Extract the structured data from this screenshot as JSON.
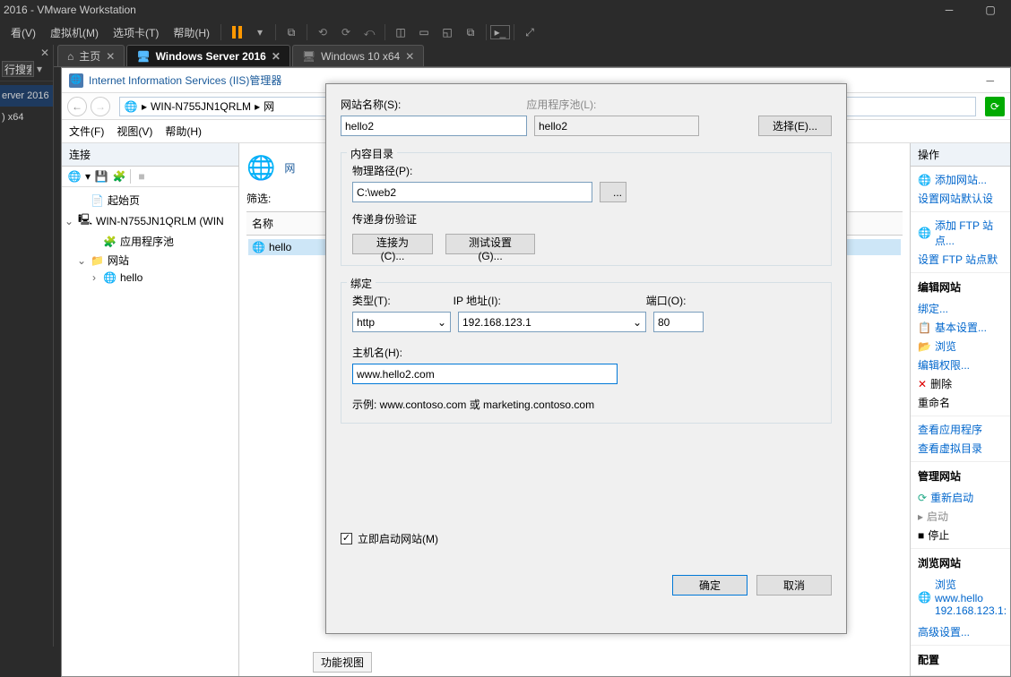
{
  "titlebar": {
    "text": "2016 - VMware Workstation"
  },
  "menu": {
    "view": "看(V)",
    "vm": "虚拟机(M)",
    "tabs": "选项卡(T)",
    "help": "帮助(H)"
  },
  "left_sliver": {
    "search": "行搜索",
    "entry1": "erver 2016",
    "entry2": ") x64"
  },
  "tabs": {
    "home": "主页",
    "active": "Windows Server 2016",
    "other": "Windows 10 x64"
  },
  "iis": {
    "title": "Internet Information Services (IIS)管理器",
    "path_host": "WIN-N755JN1QRLM",
    "path_arrow": "▸",
    "path_tail": "网",
    "menu_file": "文件(F)",
    "menu_view": "视图(V)",
    "menu_help": "帮助(H)",
    "left_hdr": "连接",
    "tree_start": "起始页",
    "tree_host": "WIN-N755JN1QRLM (WIN",
    "tree_pool": "应用程序池",
    "tree_sites": "网站",
    "tree_hello": "hello",
    "mid_title": "网",
    "mid_filter": "筛选:",
    "mid_col": "名称",
    "mid_item": "hello",
    "right_hdr": "操作",
    "act_add": "添加网站...",
    "act_def": "设置网站默认设",
    "act_ftp_add": "添加 FTP 站点...",
    "act_ftp_def": "设置 FTP 站点默",
    "sec_edit": "编辑网站",
    "act_bind": "绑定...",
    "act_basic": "基本设置...",
    "act_browse": "浏览",
    "act_perm": "编辑权限...",
    "act_delete": "删除",
    "act_rename": "重命名",
    "act_apps": "查看应用程序",
    "act_vdirs": "查看虚拟目录",
    "sec_manage": "管理网站",
    "act_restart": "重新启动",
    "act_start": "启动",
    "act_stop": "停止",
    "sec_browse": "浏览网站",
    "act_browse_url1": "浏览 www.hello",
    "act_browse_url2": "192.168.123.1:",
    "act_adv": "高级设置...",
    "sec_config": "配置",
    "bottom_tab": "功能视图"
  },
  "dlg": {
    "lbl_name": "网站名称(S):",
    "lbl_pool": "应用程序池(L):",
    "name": "hello2",
    "pool": "hello2",
    "select_btn": "选择(E)...",
    "grp_content": "内容目录",
    "lbl_path": "物理路径(P):",
    "path": "C:\\web2",
    "browse": "...",
    "lbl_auth": "传递身份验证",
    "btn_connect": "连接为(C)...",
    "btn_test": "测试设置(G)...",
    "grp_bind": "绑定",
    "lbl_type": "类型(T):",
    "lbl_ip": "IP 地址(I):",
    "lbl_port": "端口(O):",
    "type": "http",
    "ip": "192.168.123.1",
    "port": "80",
    "lbl_host": "主机名(H):",
    "host": "www.hello2.com",
    "example": "示例: www.contoso.com 或 marketing.contoso.com",
    "cb_start": "立即启动网站(M)",
    "ok": "确定",
    "cancel": "取消"
  }
}
